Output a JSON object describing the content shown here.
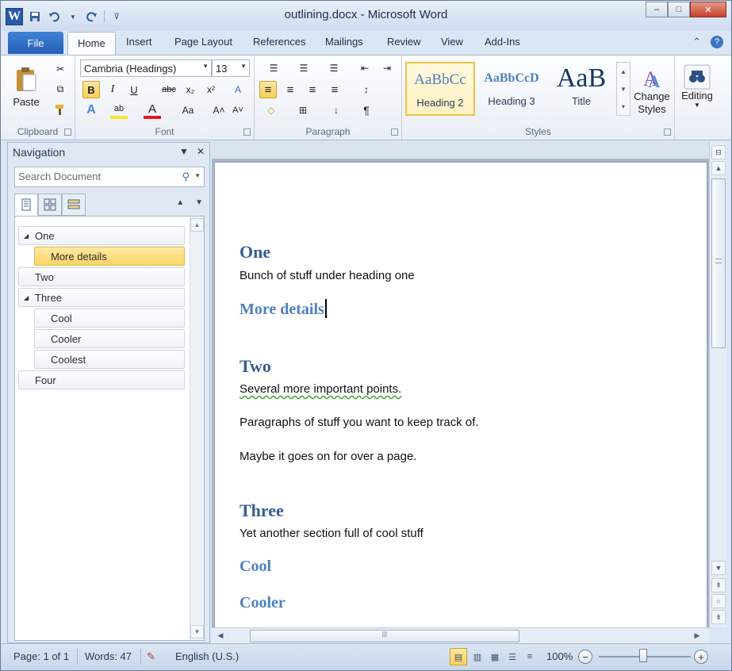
{
  "window": {
    "title": "outlining.docx - Microsoft Word",
    "controls": {
      "minimize": "–",
      "maximize": "□",
      "close": "✕"
    }
  },
  "quick_access": {
    "app_icon": "W",
    "items": [
      {
        "name": "save-icon",
        "glyph": "▪"
      },
      {
        "name": "undo-icon",
        "glyph": "↶"
      },
      {
        "name": "dropdown-icon",
        "glyph": "▾"
      },
      {
        "name": "redo-icon",
        "glyph": "↻"
      },
      {
        "name": "customize-icon",
        "glyph": "⊽"
      }
    ]
  },
  "tabs": {
    "file": "File",
    "items": [
      "Home",
      "Insert",
      "Page Layout",
      "References",
      "Mailings",
      "Review",
      "View",
      "Add-Ins"
    ],
    "active": "Home",
    "right_icons": {
      "help": "?",
      "minimize_ribbon": "⌃"
    }
  },
  "ribbon": {
    "clipboard": {
      "label": "Clipboard",
      "paste": "Paste",
      "cut_icon": "✂",
      "copy_icon": "⧉",
      "format_painter_icon": "🖌"
    },
    "font": {
      "label": "Font",
      "font_name": "Cambria (Headings)",
      "font_size": "13",
      "bold": "B",
      "italic": "I",
      "underline": "U",
      "strikethrough": "abc",
      "subscript": "x₂",
      "superscript": "x²",
      "clear": "A",
      "text_effects": "A",
      "highlight": "ab",
      "font_color": "A",
      "change_case": "Aa",
      "grow": "A˄",
      "shrink": "A˅",
      "font_color_hex": "#e31b1b",
      "highlight_hex": "#f7e62b"
    },
    "paragraph": {
      "label": "Paragraph",
      "bullets": "☰",
      "numbering": "☰",
      "multilevel": "☰",
      "decrease_indent": "⇤",
      "increase_indent": "⇥",
      "align_left": "≡",
      "center": "≡",
      "align_right": "≡",
      "justify": "≡",
      "line_spacing": "↕",
      "shading": "◇",
      "borders": "⊞",
      "sort": "↓",
      "show_marks": "¶"
    },
    "styles": {
      "label": "Styles",
      "items": [
        {
          "preview": "AaBbCc",
          "name": "Heading 2",
          "selected": true
        },
        {
          "preview": "AaBbCcD",
          "name": "Heading 3",
          "selected": false
        },
        {
          "preview": "AaB",
          "name": "Title",
          "selected": false
        }
      ],
      "change_styles": "Change Styles"
    },
    "editing": {
      "label": "Editing"
    }
  },
  "navigation": {
    "title": "Navigation",
    "search_placeholder": "Search Document",
    "view_icons": [
      "page-headings",
      "page-thumbnails",
      "search-results"
    ],
    "items": [
      {
        "label": "One",
        "level": 1,
        "expanded": true,
        "selected": false
      },
      {
        "label": "More details",
        "level": 2,
        "expanded": false,
        "selected": true
      },
      {
        "label": "Two",
        "level": 1,
        "expanded": false,
        "selected": false
      },
      {
        "label": "Three",
        "level": 1,
        "expanded": true,
        "selected": false
      },
      {
        "label": "Cool",
        "level": 2,
        "expanded": false,
        "selected": false
      },
      {
        "label": "Cooler",
        "level": 2,
        "expanded": false,
        "selected": false
      },
      {
        "label": "Coolest",
        "level": 2,
        "expanded": false,
        "selected": false
      },
      {
        "label": "Four",
        "level": 1,
        "expanded": false,
        "selected": false
      }
    ]
  },
  "document": {
    "blocks": [
      {
        "type": "h1",
        "text": "One"
      },
      {
        "type": "p",
        "text": "Bunch of stuff under heading one"
      },
      {
        "type": "h2",
        "text": "More details",
        "caret": true
      },
      {
        "type": "h1",
        "text": "Two"
      },
      {
        "type": "p",
        "text": "Several more important points.",
        "squiggle": true
      },
      {
        "type": "p",
        "text": "Paragraphs of stuff you want to keep track of."
      },
      {
        "type": "p",
        "text": "Maybe it goes on for over a page."
      },
      {
        "type": "h1",
        "text": "Three"
      },
      {
        "type": "p",
        "text": "Yet another section full of cool stuff"
      },
      {
        "type": "h2",
        "text": "Cool"
      },
      {
        "type": "h2",
        "text": "Cooler"
      }
    ]
  },
  "status": {
    "page": "Page: 1 of 1",
    "words": "Words: 47",
    "language": "English (U.S.)",
    "zoom": "100%",
    "zoom_percent": 100
  }
}
